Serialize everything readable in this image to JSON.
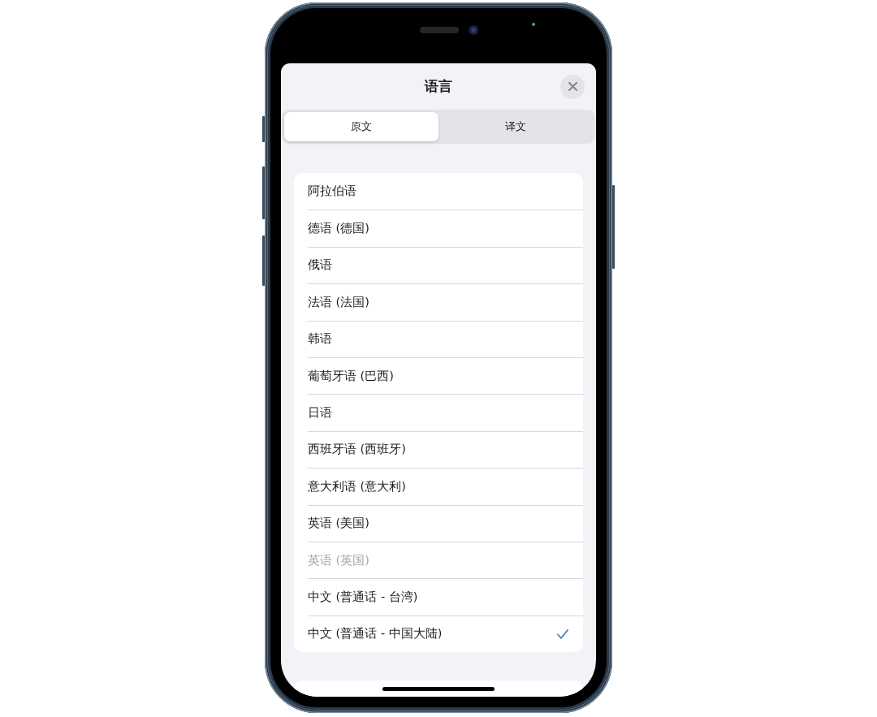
{
  "sheet": {
    "title": "语言"
  },
  "tabs": [
    {
      "label": "原文",
      "selected": true
    },
    {
      "label": "译文",
      "selected": false
    }
  ],
  "languages": [
    {
      "label": "阿拉伯语",
      "selected": false,
      "disabled": false
    },
    {
      "label": "德语 (德国)",
      "selected": false,
      "disabled": false
    },
    {
      "label": "俄语",
      "selected": false,
      "disabled": false
    },
    {
      "label": "法语 (法国)",
      "selected": false,
      "disabled": false
    },
    {
      "label": "韩语",
      "selected": false,
      "disabled": false
    },
    {
      "label": "葡萄牙语 (巴西)",
      "selected": false,
      "disabled": false
    },
    {
      "label": "日语",
      "selected": false,
      "disabled": false
    },
    {
      "label": "西班牙语 (西班牙)",
      "selected": false,
      "disabled": false
    },
    {
      "label": "意大利语 (意大利)",
      "selected": false,
      "disabled": false
    },
    {
      "label": "英语 (美国)",
      "selected": false,
      "disabled": false
    },
    {
      "label": "英语 (英国)",
      "selected": false,
      "disabled": true
    },
    {
      "label": "中文 (普通话 - 台湾)",
      "selected": false,
      "disabled": false
    },
    {
      "label": "中文 (普通话 - 中国大陆)",
      "selected": true,
      "disabled": false
    }
  ]
}
